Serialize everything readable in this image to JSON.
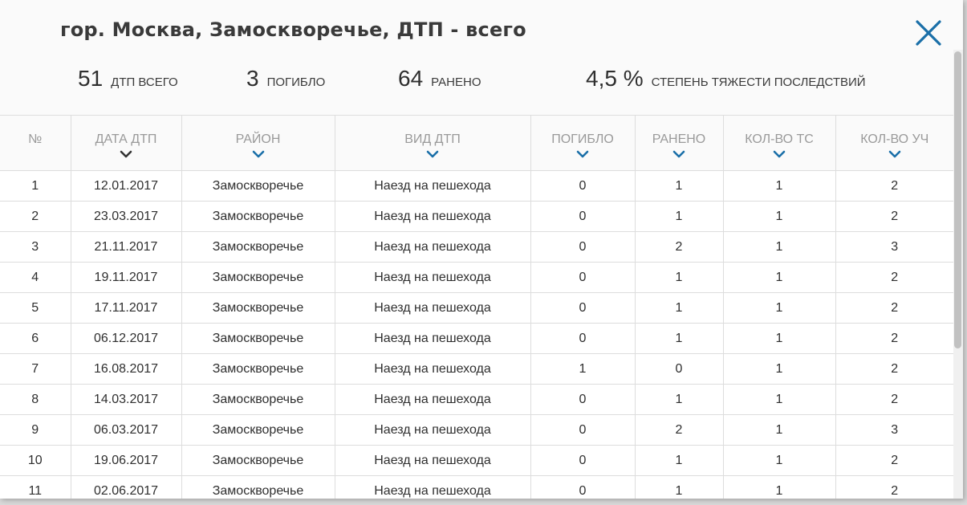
{
  "modal": {
    "title": "гор. Москва, Замоскворечье, ДТП - всего",
    "close_icon": "close-icon"
  },
  "stats": [
    {
      "value": "51",
      "label": "ДТП всего"
    },
    {
      "value": "3",
      "label": "погибло"
    },
    {
      "value": "64",
      "label": "ранено"
    },
    {
      "value": "4,5 %",
      "label": "степень тяжести последствий"
    }
  ],
  "table": {
    "columns": [
      "№",
      "Дата ДТП",
      "Район",
      "Вид ДТП",
      "Погибло",
      "Ранено",
      "Кол-во ТС",
      "Кол-во уч"
    ],
    "sort_icon": "chevron-down-icon",
    "colors": {
      "active_sort": "#333333",
      "sort": "#1a6fa8"
    },
    "rows": [
      [
        "1",
        "12.01.2017",
        "Замоскворечье",
        "Наезд на пешехода",
        "0",
        "1",
        "1",
        "2"
      ],
      [
        "2",
        "23.03.2017",
        "Замоскворечье",
        "Наезд на пешехода",
        "0",
        "1",
        "1",
        "2"
      ],
      [
        "3",
        "21.11.2017",
        "Замоскворечье",
        "Наезд на пешехода",
        "0",
        "2",
        "1",
        "3"
      ],
      [
        "4",
        "19.11.2017",
        "Замоскворечье",
        "Наезд на пешехода",
        "0",
        "1",
        "1",
        "2"
      ],
      [
        "5",
        "17.11.2017",
        "Замоскворечье",
        "Наезд на пешехода",
        "0",
        "1",
        "1",
        "2"
      ],
      [
        "6",
        "06.12.2017",
        "Замоскворечье",
        "Наезд на пешехода",
        "0",
        "1",
        "1",
        "2"
      ],
      [
        "7",
        "16.08.2017",
        "Замоскворечье",
        "Наезд на пешехода",
        "1",
        "0",
        "1",
        "2"
      ],
      [
        "8",
        "14.03.2017",
        "Замоскворечье",
        "Наезд на пешехода",
        "0",
        "1",
        "1",
        "2"
      ],
      [
        "9",
        "06.03.2017",
        "Замоскворечье",
        "Наезд на пешехода",
        "0",
        "2",
        "1",
        "3"
      ],
      [
        "10",
        "19.06.2017",
        "Замоскворечье",
        "Наезд на пешехода",
        "0",
        "1",
        "1",
        "2"
      ],
      [
        "11",
        "02.06.2017",
        "Замоскворечье",
        "Наезд на пешехода",
        "0",
        "1",
        "1",
        "2"
      ]
    ]
  }
}
